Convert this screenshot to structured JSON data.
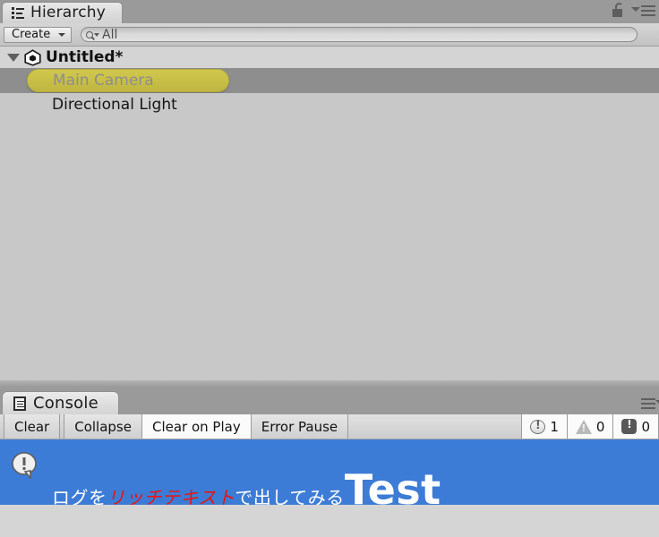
{
  "hierarchy": {
    "tab_label": "Hierarchy",
    "tab_icon": "hierarchy-list-icon",
    "lock_icon": "lock-open-icon",
    "menu_icon": "hamburger-menu-icon",
    "toolbar": {
      "create_label": "Create",
      "create_caret_icon": "chevron-down-icon",
      "search_icon": "search-magnifier-icon",
      "search_caret_icon": "chevron-down-icon",
      "search_value": "All",
      "search_placeholder": "All"
    },
    "tree": {
      "scene": {
        "name": "Untitled*",
        "expand_icon": "triangle-down-icon",
        "scene_icon": "unity-logo-icon",
        "expanded": true
      },
      "items": [
        {
          "name": "Main Camera",
          "state": "dragging-selected"
        },
        {
          "name": "Directional Light",
          "state": "normal"
        }
      ]
    }
  },
  "console": {
    "tab_label": "Console",
    "tab_icon": "console-document-icon",
    "menu_icon": "hamburger-menu-icon",
    "toolbar": {
      "clear_label": "Clear",
      "collapse_label": "Collapse",
      "clear_on_play_label": "Clear on Play",
      "error_pause_label": "Error Pause",
      "counters": [
        {
          "icon": "info-speech-bubble-icon",
          "count": "1",
          "kind": "info"
        },
        {
          "icon": "warning-triangle-icon",
          "count": "0",
          "kind": "warning"
        },
        {
          "icon": "error-octagon-icon",
          "count": "0",
          "kind": "error"
        }
      ]
    },
    "log_entries": [
      {
        "icon": "info-speech-bubble-icon",
        "selected": true,
        "segments": [
          {
            "text": "ログを",
            "style": "plain"
          },
          {
            "text": "リッチテキスト",
            "style": "red-italic"
          },
          {
            "text": "で出してみる",
            "style": "plain"
          },
          {
            "text": "Test",
            "style": "large-bold"
          }
        ]
      }
    ]
  },
  "colors": {
    "selection_blue": "#3d7cd6",
    "rich_text_red": "#e8140c",
    "drag_pill_yellow": "#c8bf47",
    "panel_bg": "#c8c8c8",
    "chrome_bg": "#9a9a9a"
  }
}
